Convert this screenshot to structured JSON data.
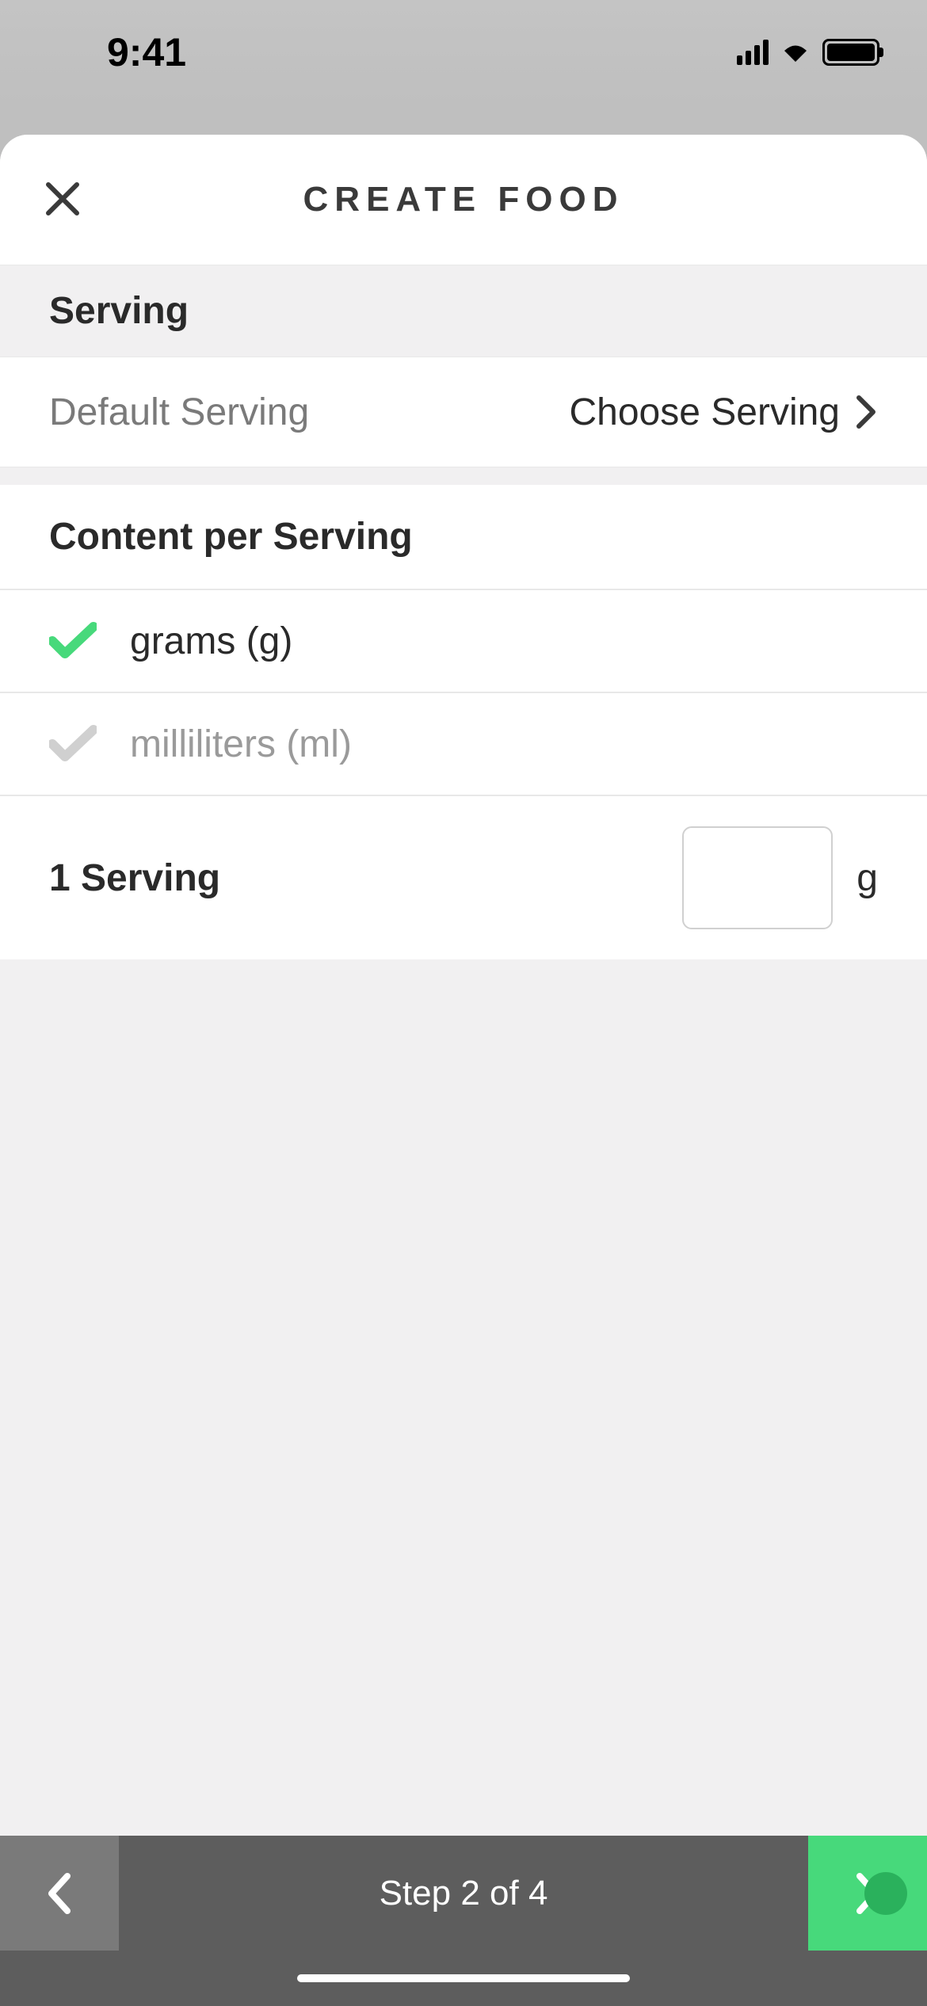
{
  "status": {
    "time": "9:41"
  },
  "header": {
    "title": "CREATE FOOD"
  },
  "sections": {
    "serving": {
      "title": "Serving",
      "default_serving_label": "Default Serving",
      "default_serving_value": "Choose Serving"
    },
    "content": {
      "title": "Content per Serving",
      "units": [
        {
          "label": "grams (g)",
          "selected": true
        },
        {
          "label": "milliliters (ml)",
          "selected": false
        }
      ],
      "serving_amount_label": "1 Serving",
      "serving_amount_value": "",
      "unit_suffix": "g"
    }
  },
  "footer": {
    "step_text": "Step 2 of 4"
  }
}
